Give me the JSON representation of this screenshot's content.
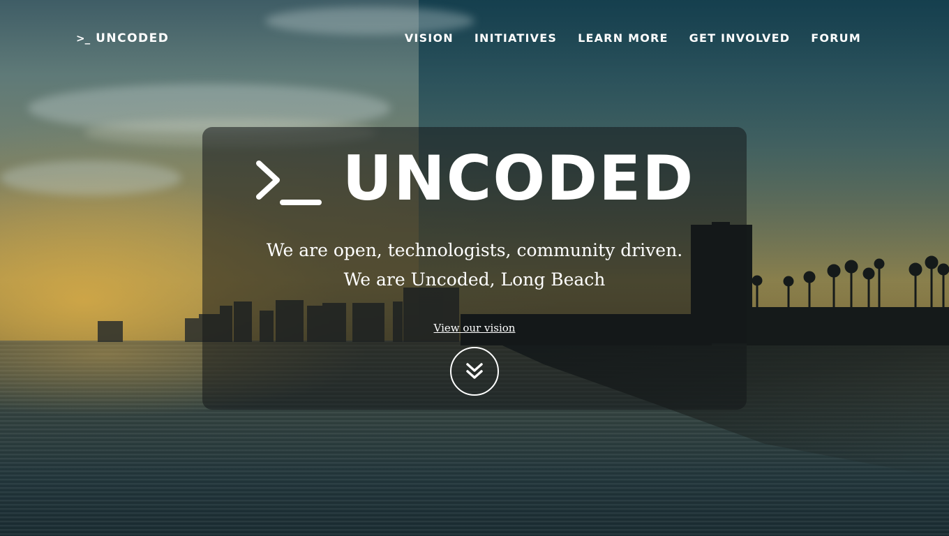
{
  "nav": {
    "brand": {
      "prompt": ">_",
      "name": "UNCODED"
    },
    "links": [
      {
        "label": "VISION"
      },
      {
        "label": "INITIATIVES"
      },
      {
        "label": "LEARN MORE"
      },
      {
        "label": "GET INVOLVED"
      },
      {
        "label": "FORUM"
      }
    ]
  },
  "hero": {
    "title": "UNCODED",
    "title_icon": "terminal-prompt-icon",
    "tagline_line1": "We are open, technologists, community driven.",
    "tagline_line2": "We are Uncoded, Long Beach",
    "cta_label": "View our vision",
    "cta_icon": "double-chevron-down-icon"
  },
  "colors": {
    "text": "#ffffff",
    "card_overlay": "rgba(20,24,26,0.55)",
    "sky_top": "#3f5d66",
    "sunset": "#d6aa46",
    "water": "#22363b"
  }
}
